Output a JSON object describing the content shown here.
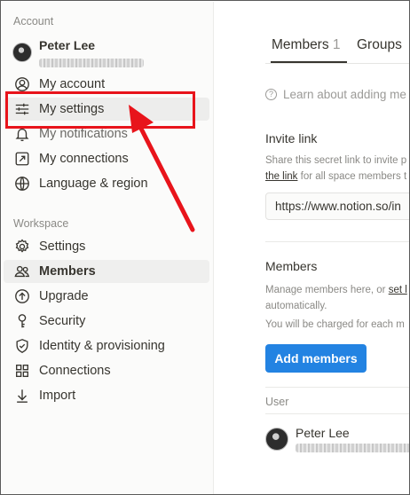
{
  "sidebar": {
    "account_label": "Account",
    "user_name": "Peter Lee",
    "account_items": [
      {
        "label": "My account",
        "icon": "user-circle-icon"
      },
      {
        "label": "My settings",
        "icon": "sliders-icon"
      },
      {
        "label": "My notifications",
        "icon": "bell-icon"
      },
      {
        "label": "My connections",
        "icon": "external-link-icon"
      },
      {
        "label": "Language & region",
        "icon": "globe-icon"
      }
    ],
    "workspace_label": "Workspace",
    "workspace_items": [
      {
        "label": "Settings",
        "icon": "gear-icon"
      },
      {
        "label": "Members",
        "icon": "people-icon"
      },
      {
        "label": "Upgrade",
        "icon": "arrow-up-circle-icon"
      },
      {
        "label": "Security",
        "icon": "key-icon"
      },
      {
        "label": "Identity & provisioning",
        "icon": "shield-check-icon"
      },
      {
        "label": "Connections",
        "icon": "grid-icon"
      },
      {
        "label": "Import",
        "icon": "download-icon"
      }
    ]
  },
  "main": {
    "tabs": [
      {
        "label": "Members",
        "count": "1"
      },
      {
        "label": "Groups"
      }
    ],
    "learn_text": "Learn about adding me",
    "invite": {
      "title": "Invite link",
      "desc_line1": "Share this secret link to invite p",
      "desc_link": "the link",
      "desc_line2_rest": " for all space members t",
      "url": "https://www.notion.so/in"
    },
    "members": {
      "title": "Members",
      "desc_line1_pre": "Manage members here, or ",
      "desc_line1_link": "set l",
      "desc_line2": "automatically.",
      "desc_line3": "You will be charged for each m",
      "add_button": "Add members"
    },
    "table": {
      "column_user": "User",
      "rows": [
        {
          "name": "Peter Lee"
        }
      ]
    }
  },
  "colors": {
    "accent": "#2383e2",
    "highlight_red": "#e8141b",
    "sidebar_bg": "#fbfbfa"
  }
}
